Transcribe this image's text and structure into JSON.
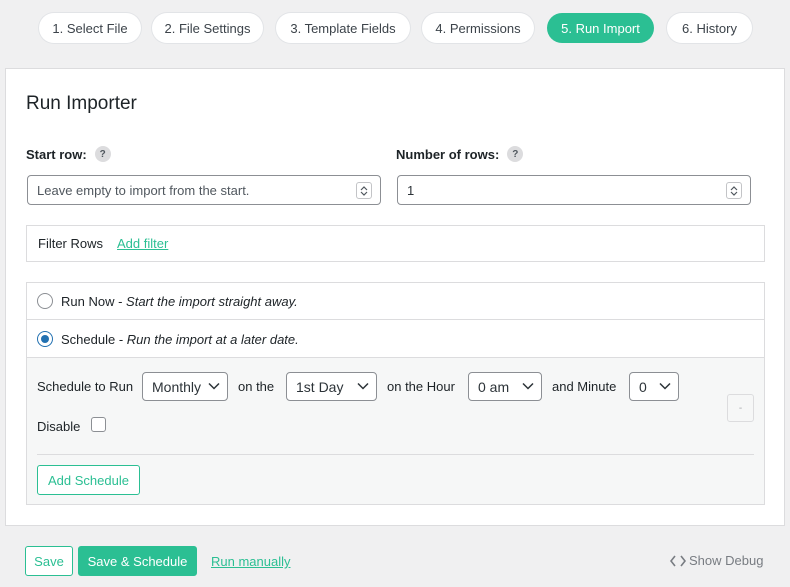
{
  "steps": [
    {
      "label": "1. Select File"
    },
    {
      "label": "2. File Settings"
    },
    {
      "label": "3. Template Fields"
    },
    {
      "label": "4. Permissions"
    },
    {
      "label": "5. Run Import",
      "active": true
    },
    {
      "label": "6. History"
    }
  ],
  "colors": {
    "accent": "#2bbf93",
    "radio": "#2271b1"
  },
  "importer": {
    "title": "Run Importer",
    "start_row": {
      "label": "Start row:",
      "help": "?",
      "placeholder": "Leave empty to import from the start.",
      "value": ""
    },
    "num_rows": {
      "label": "Number of rows:",
      "help": "?",
      "value": "1"
    },
    "filter": {
      "label": "Filter Rows",
      "add_link": "Add filter"
    },
    "run_now": {
      "label": "Run Now",
      "desc": "Start the import straight away.",
      "checked": false
    },
    "schedule": {
      "label": "Schedule",
      "desc": "Run the import at a later date.",
      "checked": true,
      "to_run_label": "Schedule to Run",
      "frequency": "Monthly",
      "on_the_label": "on the",
      "day": "1st Day",
      "hour_label": "on the Hour",
      "hour": "0 am",
      "minute_label": "and Minute",
      "minute": "0",
      "disable_label": "Disable",
      "disable_checked": false,
      "remove_button": "-",
      "add_button": "Add Schedule"
    }
  },
  "footer": {
    "save": "Save",
    "save_schedule": "Save & Schedule",
    "run_manually": "Run manually",
    "show_debug": "Show Debug"
  }
}
